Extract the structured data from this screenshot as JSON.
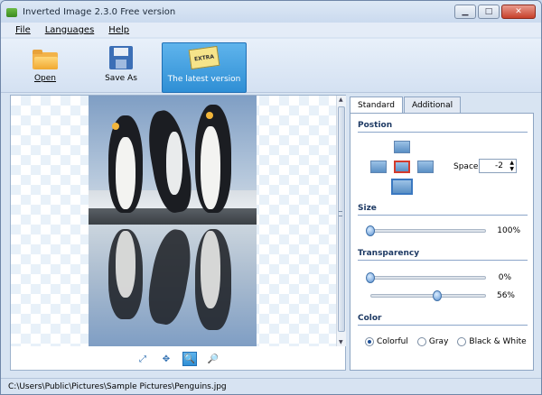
{
  "window": {
    "title": "Inverted Image 2.3.0 Free version",
    "minimize_label": "▁",
    "maximize_label": "□",
    "close_label": "✕"
  },
  "menu": {
    "items": [
      "File",
      "Languages",
      "Help"
    ]
  },
  "toolbar": {
    "open_label": "Open",
    "save_as_label": "Save As",
    "latest_label": "The latest version",
    "latest_icon_text": "EXTRA"
  },
  "preview": {
    "zoom_buttons": [
      {
        "icon": "fit-icon",
        "glyph": "⤢"
      },
      {
        "icon": "move-icon",
        "glyph": "✥"
      },
      {
        "icon": "zoom-in-icon",
        "glyph": "🔍"
      },
      {
        "icon": "zoom-out-icon",
        "glyph": "🔎"
      }
    ]
  },
  "panel": {
    "tabs": [
      "Standard",
      "Additional"
    ],
    "position_title": "Postion",
    "space_label": "Space",
    "space_value": "-2",
    "size_title": "Size",
    "size_value": "100%",
    "size_level": 0.0,
    "transparency_title": "Transparency",
    "transparency_value_1": "0%",
    "transparency_level_1": 0.0,
    "transparency_value_2": "56%",
    "transparency_level_2": 0.56,
    "color_title": "Color",
    "color_options": [
      "Colorful",
      "Gray",
      "Black & White"
    ],
    "color_selected": "Colorful"
  },
  "status": {
    "path": "C:\\Users\\Public\\Pictures\\Sample Pictures\\Penguins.jpg"
  },
  "colors": {
    "accent": "#2f8fd5",
    "section_title": "#1e3a64"
  }
}
